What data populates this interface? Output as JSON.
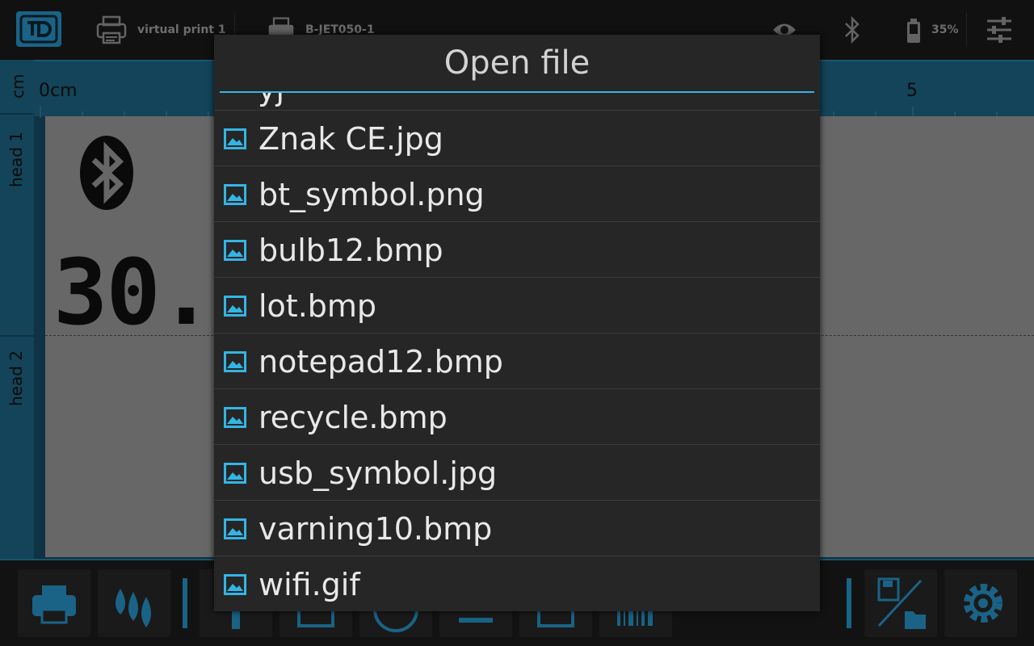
{
  "status_bar": {
    "printers": [
      {
        "name": "virtual print 1"
      },
      {
        "name": "B-JET050-1"
      }
    ],
    "battery_percent": "35%"
  },
  "editor": {
    "ruler_unit": "cm",
    "ruler_start": "0cm",
    "ruler_mark_5": "5",
    "heads": [
      "head 1",
      "head 2"
    ],
    "partial_text": "30."
  },
  "dialog": {
    "title": "Open file",
    "partial_item": "yj",
    "files": [
      {
        "name": "Znak CE.jpg",
        "icon": "image-icon"
      },
      {
        "name": "bt_symbol.png",
        "icon": "image-icon"
      },
      {
        "name": "bulb12.bmp",
        "icon": "image-icon"
      },
      {
        "name": "lot.bmp",
        "icon": "image-icon"
      },
      {
        "name": "notepad12.bmp",
        "icon": "image-icon"
      },
      {
        "name": "recycle.bmp",
        "icon": "image-icon"
      },
      {
        "name": "usb_symbol.jpg",
        "icon": "image-icon"
      },
      {
        "name": "varning10.bmp",
        "icon": "image-icon"
      },
      {
        "name": "wifi.gif",
        "icon": "image-icon"
      }
    ]
  },
  "toolbar": {
    "buttons": [
      "print-icon",
      "ink-drops-icon",
      "text-icon",
      "frame-icon",
      "clock-icon",
      "counter-icon",
      "image-icon",
      "barcode-icon",
      "save-open-icon",
      "settings-icon"
    ]
  },
  "colors": {
    "accent": "#33b5e5",
    "brand": "#2aa0d8",
    "dialog_bg": "#262626",
    "ruler": "#1f6f92"
  }
}
